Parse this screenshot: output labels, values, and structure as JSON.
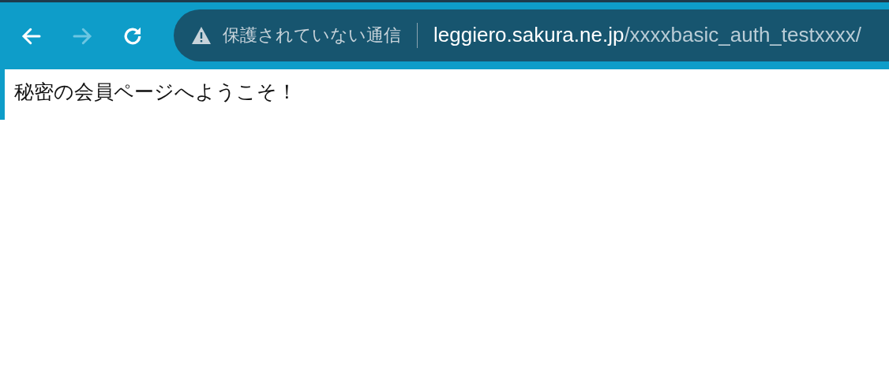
{
  "toolbar": {
    "nav_buttons": [
      {
        "kind": "back",
        "disabled": false
      },
      {
        "kind": "forward",
        "disabled": true
      },
      {
        "kind": "reload",
        "disabled": false
      }
    ],
    "address_bar": {
      "security_label": "保護されていない通信",
      "host": "leggiero.sakura.ne.jp",
      "path": "/xxxxbasic_auth_testxxxx/"
    }
  },
  "page": {
    "heading": "秘密の会員ページへようこそ！"
  }
}
